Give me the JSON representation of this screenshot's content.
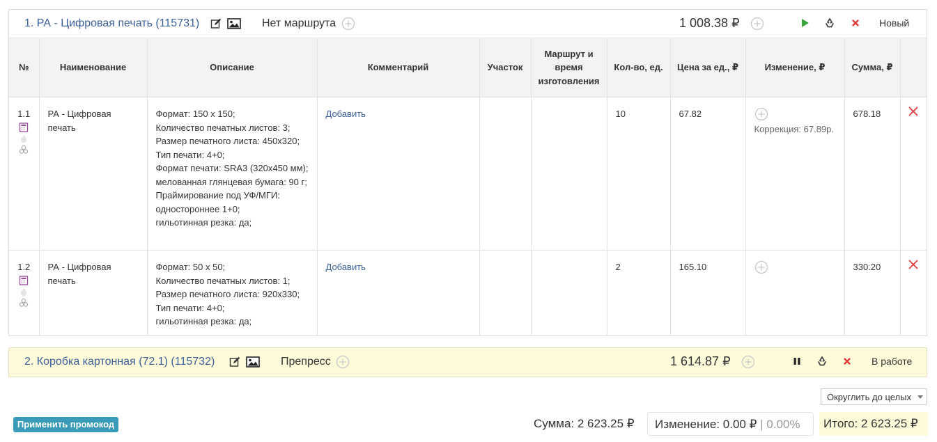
{
  "orders": [
    {
      "title": "1. РА - Цифровая печать (115731)",
      "route": "Нет маршрута",
      "total": "1 008.38 ₽",
      "status": "Новый"
    },
    {
      "title": "2. Коробка картонная (72.1) (115732)",
      "route": "Препресс",
      "total": "1 614.87 ₽",
      "status": "В работе"
    }
  ],
  "table": {
    "headers": [
      "№",
      "Наименование",
      "Описание",
      "Комментарий",
      "Участок",
      "Маршрут и время изготовления",
      "Кол-во, ед.",
      "Цена за ед., ₽",
      "Изменение, ₽",
      "Сумма, ₽"
    ],
    "rows": [
      {
        "num": "1.1",
        "name": "РА - Цифровая печать",
        "description": [
          "Формат: 150 x 150;",
          "Количество печатных листов: 3;",
          "Размер печатного листа: 450x320;",
          "Тип печати: 4+0;",
          "Формат печати: SRA3 (320x450 мм);",
          "мелованная глянцевая бумага: 90 г;",
          "Праймирование под УФ/МГИ: одностороннее 1+0;",
          "гильотинная резка: да;"
        ],
        "comment_link": "Добавить",
        "qty": "10",
        "price": "67.82",
        "correction": "Коррекция: 67.89р.",
        "sum": "678.18"
      },
      {
        "num": "1.2",
        "name": "РА - Цифровая печать",
        "description": [
          "Формат: 50 x 50;",
          "Количество печатных листов: 1;",
          "Размер печатного листа: 920x330;",
          "Тип печати: 4+0;",
          "гильотинная резка: да;"
        ],
        "comment_link": "Добавить",
        "qty": "2",
        "price": "165.10",
        "correction": "",
        "sum": "330.20"
      }
    ]
  },
  "footer": {
    "round_option": "Округлить до целых",
    "promo_button": "Применить промокод",
    "sum_text": "Сумма: 2 623.25 ₽",
    "change_text": "Изменение: 0.00 ₽",
    "change_sep": " | ",
    "change_pct": "0.00%",
    "total_text": "Итого: 2 623.25 ₽"
  },
  "colors": {
    "link": "#3b5f9a",
    "highlight_bg": "#fdfbd9",
    "play": "#3aa53a",
    "delete": "#e03a3a",
    "promo_bg": "#3a9bb8"
  }
}
